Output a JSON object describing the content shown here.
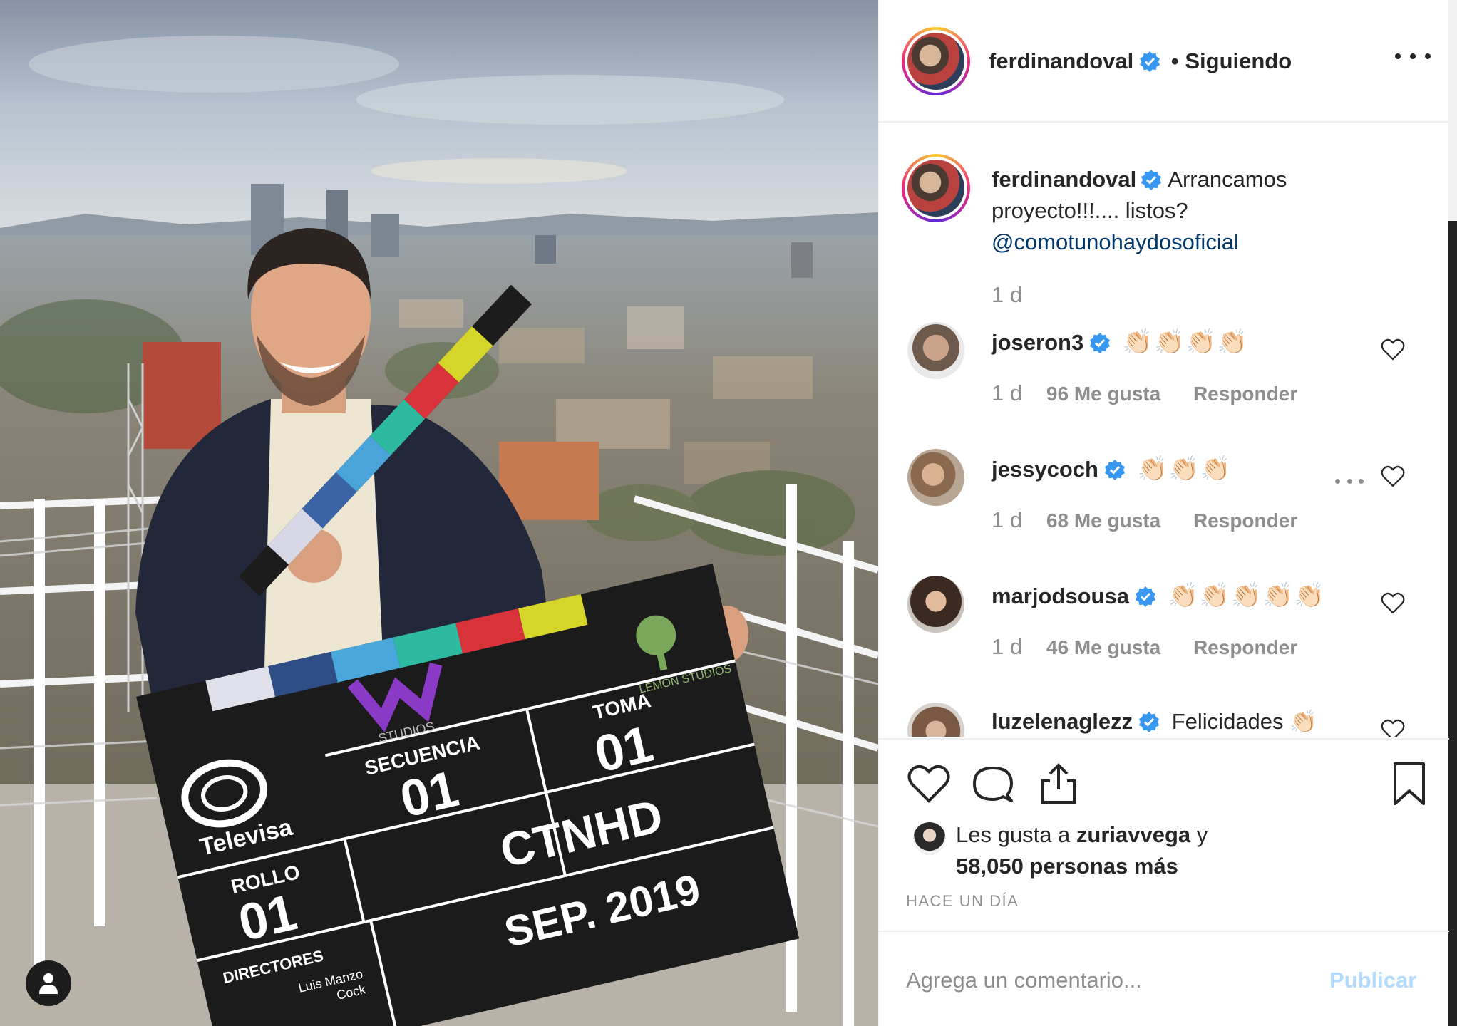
{
  "header": {
    "username": "ferdinandoval",
    "follow_status": "• Siguiendo"
  },
  "caption": {
    "username": "ferdinandoval",
    "text": "Arrancamos proyecto!!!.... listos?",
    "mention": "@comotunohaydosoficial",
    "time": "1 d"
  },
  "comments": [
    {
      "username": "joseron3",
      "text": "👏🏻👏🏻👏🏻👏🏻",
      "time": "1 d",
      "likes": "96 Me gusta",
      "reply": "Responder"
    },
    {
      "username": "jessycoch",
      "text": "👏🏻👏🏻👏🏻",
      "time": "1 d",
      "likes": "68 Me gusta",
      "reply": "Responder"
    },
    {
      "username": "marjodsousa",
      "text": "👏🏻👏🏻👏🏻👏🏻👏🏻",
      "time": "1 d",
      "likes": "46 Me gusta",
      "reply": "Responder"
    },
    {
      "username": "luzelenaglezz",
      "text": "Felicidades 👏🏻",
      "time": "",
      "likes": "",
      "reply": ""
    }
  ],
  "likes": {
    "prefix": "Les gusta a ",
    "friend": "zuriavvega",
    "connector": " y",
    "count": "58,050 personas más"
  },
  "posted": "HACE UN DÍA",
  "add_comment": {
    "placeholder": "Agrega un comentario...",
    "publish": "Publicar"
  },
  "photo": {
    "clapper": {
      "brand": "Televisa",
      "studio": "STUDIOS",
      "producer": "LEMON STUDIOS",
      "rollo_label": "ROLLO",
      "rollo": "01",
      "secuencia_label": "SECUENCIA",
      "secuencia": "01",
      "toma_label": "TOMA",
      "toma": "01",
      "title": "CTNHD",
      "directores_label": "DIRECTORES",
      "date": "SEP. 2019",
      "director_fragment": "Luis Manzo",
      "director_fragment2": "Cock"
    }
  },
  "colors": {
    "accent_blue": "#0095f6",
    "mention": "#00376b",
    "muted": "#8e8e8e",
    "publish_disabled": "#b3dbff"
  }
}
